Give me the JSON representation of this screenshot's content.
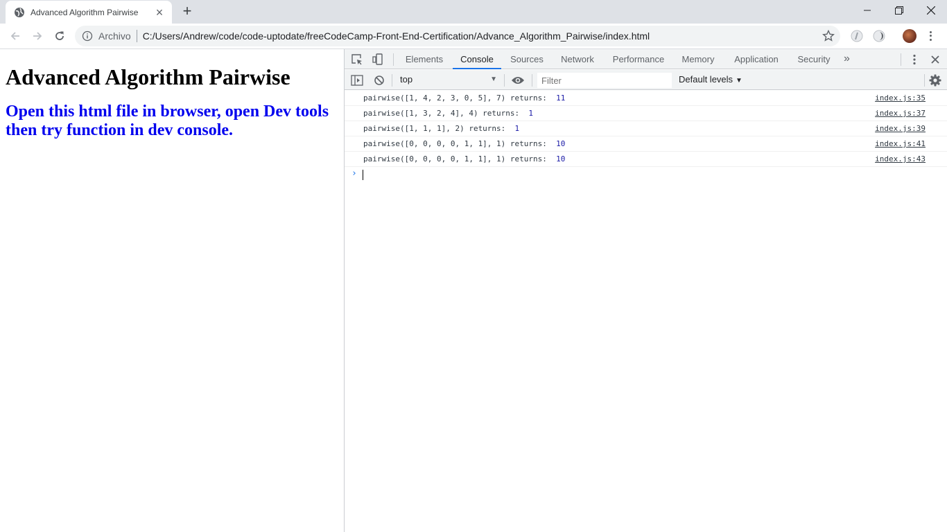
{
  "browser": {
    "tab_title": "Advanced Algorithm Pairwise",
    "scheme_label": "Archivo",
    "url": "C:/Users/Andrew/code/code-uptodate/freeCodeCamp-Front-End-Certification/Advance_Algorithm_Pairwise/index.html"
  },
  "page": {
    "heading": "Advanced Algorithm Pairwise",
    "instruction": "Open this html file in browser, open Dev tools then try function in dev console."
  },
  "devtools": {
    "tabs": [
      "Elements",
      "Console",
      "Sources",
      "Network",
      "Performance",
      "Memory",
      "Application",
      "Security"
    ],
    "active_tab": "Console",
    "more_tabs": "»",
    "context": "top",
    "filter_placeholder": "Filter",
    "levels": "Default levels",
    "logs": [
      {
        "text": "pairwise([1, 4, 2, 3, 0, 5], 7) returns: ",
        "value": "11",
        "source": "index.js:35"
      },
      {
        "text": "pairwise([1, 3, 2, 4], 4) returns: ",
        "value": "1",
        "source": "index.js:37"
      },
      {
        "text": "pairwise([1, 1, 1], 2) returns: ",
        "value": "1",
        "source": "index.js:39"
      },
      {
        "text": "pairwise([0, 0, 0, 0, 1, 1], 1) returns: ",
        "value": "10",
        "source": "index.js:41"
      },
      {
        "text": "pairwise([0, 0, 0, 0, 1, 1], 1) returns: ",
        "value": "10",
        "source": "index.js:43"
      }
    ]
  },
  "colors": {
    "tab_strip": "#dee1e6",
    "accent": "#1a73e8",
    "link_blue": "#0000ee",
    "console_number": "#1a1aa6"
  }
}
